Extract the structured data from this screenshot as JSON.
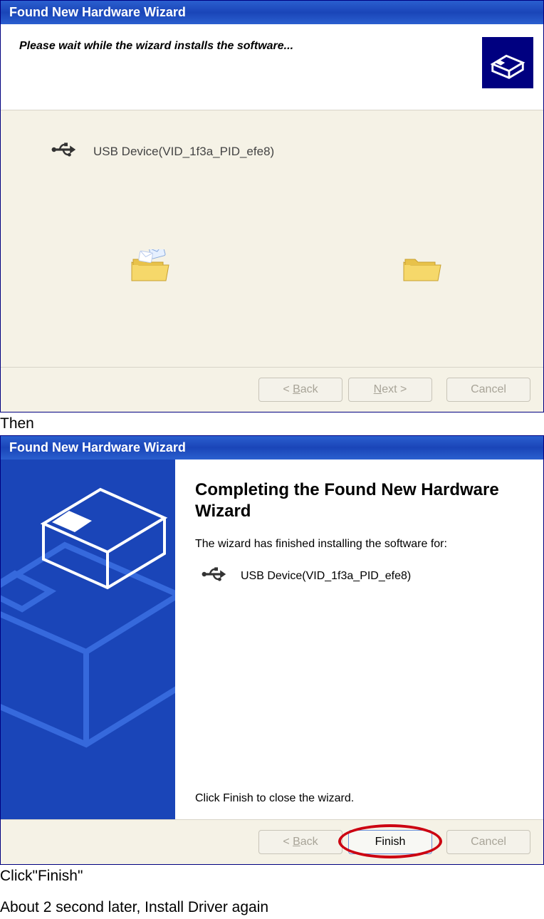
{
  "doc": {
    "then": "Then",
    "click_finish": "Click\"Finish\"",
    "install_again": "About 2 second later, Install Driver again"
  },
  "dialog1": {
    "title": "Found New Hardware Wizard",
    "header": "Please wait while the wizard installs the software...",
    "device_name": "USB Device(VID_1f3a_PID_efe8)",
    "buttons": {
      "back": "< Back",
      "next": "Next >",
      "cancel": "Cancel"
    }
  },
  "dialog2": {
    "title": "Found New Hardware Wizard",
    "heading": "Completing the Found New Hardware Wizard",
    "finished_text": "The wizard has finished installing the software for:",
    "device_name": "USB Device(VID_1f3a_PID_efe8)",
    "close_text": "Click Finish to close the wizard.",
    "buttons": {
      "back": "< Back",
      "finish": "Finish",
      "cancel": "Cancel"
    }
  }
}
